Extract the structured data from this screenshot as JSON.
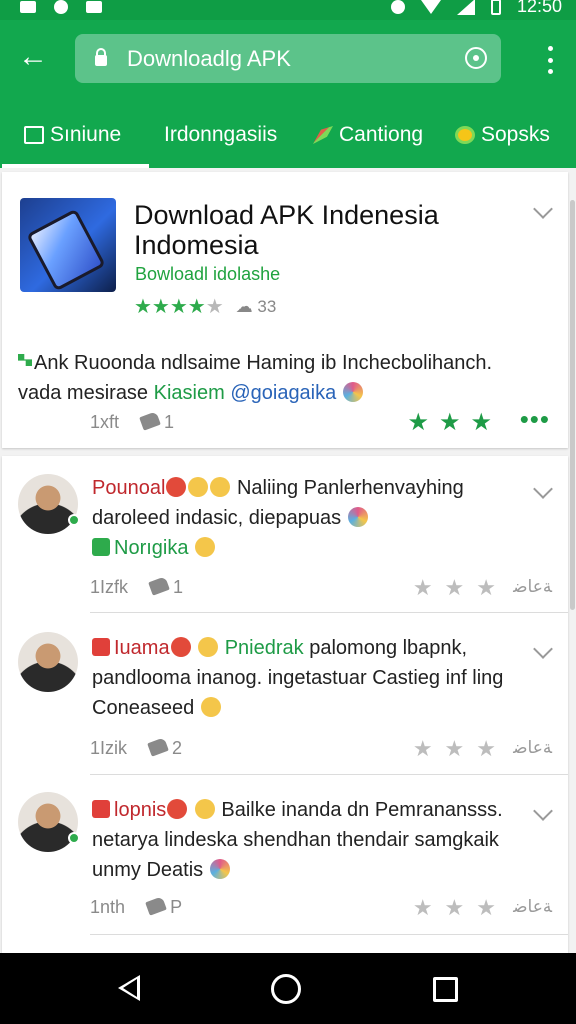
{
  "status_bar": {
    "time": "12:50"
  },
  "app_bar": {
    "url_text": "Downloadlg APK"
  },
  "tabs": [
    {
      "label": "Sıniune"
    },
    {
      "label": "Irdonngasiis"
    },
    {
      "label": "Cantiong"
    },
    {
      "label": "Sopsks"
    }
  ],
  "app_card": {
    "title": "Download APK Indenesia Indomesia",
    "subtitle": "Bowloadl idolashe",
    "rating": {
      "stars": 4,
      "max": 5,
      "count": "33"
    },
    "description": {
      "part1": "Ank Ruoonda ndlsaime Haming ib Inchecbolihanch.",
      "part2": "vada mesirase ",
      "part3": "Kiasiem",
      "part4": " @goiagaika"
    },
    "likes": "1xft",
    "replies": "1"
  },
  "comments": [
    {
      "name": "Pounoal",
      "text_inline": "Naliing Panlerhenvayhing",
      "text_line2": "daroleed indasic, diepapuas",
      "text_line3": "Norıgika",
      "likes": "1Izfk",
      "replies": "1",
      "more": "ﺔﻋﺎﺿ"
    },
    {
      "name": "Iuama",
      "name2": "Pniedrak",
      "text_inline": "palomong lbapnk,",
      "text_line2": "pandlooma inanog. ingetastuar Castieg inf ling",
      "text_line3": "Coneaseed",
      "likes": "1Izik",
      "replies": "2",
      "more": "ﺔﻋﺎﺿ"
    },
    {
      "name": "lopnis",
      "text_inline": "Bailke inanda dn Pemranansss.",
      "text_line2": "netarya lindeska shendhan thendair samgkaik",
      "text_line3": "unmy Deatis",
      "likes": "1nth",
      "replies": "P",
      "more": "ﺔﻋﺎﺿ"
    }
  ]
}
